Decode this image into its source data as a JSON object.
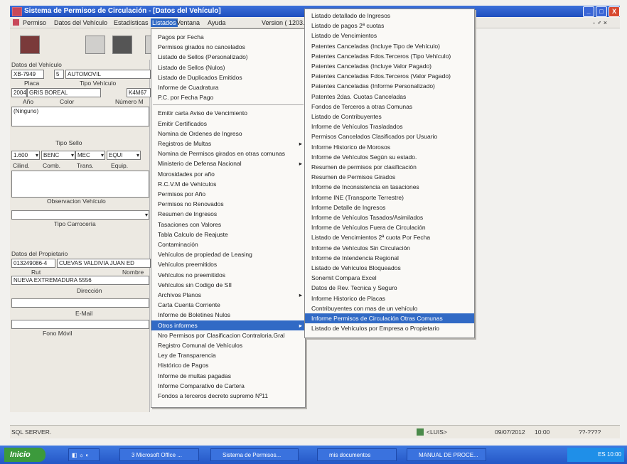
{
  "window": {
    "title": "Sistema de Permisos de Circulación - [Datos del Vehículo]",
    "controls": [
      "_",
      "□",
      "X"
    ],
    "inner_controls": "- ♂ ×"
  },
  "menubar": {
    "items": [
      "Permiso",
      "Datos del Vehículo",
      "Estadísticas",
      "Listados",
      "Ventana",
      "Ayuda"
    ],
    "version": "Version ( 1203."
  },
  "form": {
    "section_vehicle": "Datos del Vehículo",
    "plate": "XB-7949",
    "dv": "5",
    "vehicle_type_value": "AUTOMOVIL",
    "label_placa": "Placa",
    "label_tipo_vehiculo": "Tipo Vehículo",
    "year_value": "2004",
    "color_value": "GRIS BOREAL",
    "number_value": "K4M67",
    "label_ano": "Año",
    "label_color": "Color",
    "label_numero": "Número M",
    "ninguno": "(Ninguno)",
    "label_tipo_sello": "Tipo Sello",
    "cc_value": "1.600",
    "comb_value": "BENC",
    "trans_value": "MEC",
    "equip_value": "EQUI",
    "label_cilind": "Cilind.",
    "label_comb": "Comb.",
    "label_trans": "Trans.",
    "label_equip": "Equip.",
    "label_observacion": "Observacion Vehículo",
    "label_tipo_carroceria": "Tipo Carrocería",
    "section_owner": "Datos del Propietario",
    "rut_value": "013249086-4",
    "owner_name": "CUEVAS VALDIVIA JUAN ED",
    "label_rut": "Rut",
    "label_nombre": "Nombre",
    "address_value": "NUEVA EXTREMADURA 5556",
    "label_direccion": "Dirección",
    "label_email": "E-Mail",
    "label_fono": "Fono Móvil"
  },
  "listados_menu": [
    {
      "label": "Pagos por Fecha"
    },
    {
      "label": "Permisos girados no cancelados"
    },
    {
      "label": "Listado de Sellos (Personalizado)"
    },
    {
      "label": "Listado de Sellos (Nulos)"
    },
    {
      "label": "Listado de Duplicados Emitidos"
    },
    {
      "label": "Informe de Cuadratura"
    },
    {
      "label": "P.C. por Fecha Pago"
    },
    {
      "label": "Emitir carta Aviso de Vencimiento",
      "sep_before": true
    },
    {
      "label": "Emitir Certificados"
    },
    {
      "label": "Nomina de Ordenes de Ingreso"
    },
    {
      "label": "Registros de Multas",
      "sub": true
    },
    {
      "label": "Nomina de Permisos girados en otras comunas"
    },
    {
      "label": "Ministerio de Defensa Nacional",
      "sub": true
    },
    {
      "label": "Morosidades por año"
    },
    {
      "label": "R.C.V.M de Vehículos"
    },
    {
      "label": "Permisos por Año"
    },
    {
      "label": "Permisos no Renovados"
    },
    {
      "label": "Resumen de Ingresos"
    },
    {
      "label": "Tasaciones con Valores"
    },
    {
      "label": "Tabla Calculo de Reajuste"
    },
    {
      "label": "Contaminación"
    },
    {
      "label": "Vehículos de propiedad de Leasing"
    },
    {
      "label": "Vehículos preemitidos"
    },
    {
      "label": "Vehículos no preemitidos"
    },
    {
      "label": "Vehículos sin Codigo de SII"
    },
    {
      "label": "Archivos Planos",
      "sub": true
    },
    {
      "label": "Carta Cuenta Corriente"
    },
    {
      "label": "Informe de Boletines Nulos"
    },
    {
      "label": "Otros informes",
      "sub": true,
      "highlight": true
    },
    {
      "label": "Nro Permisos por Clasificacion Contraloria.Gral"
    },
    {
      "label": "Registro Comunal de Vehículos"
    },
    {
      "label": "Ley de Transparencia"
    },
    {
      "label": "Histórico de Pagos"
    },
    {
      "label": "Informe de multas pagadas"
    },
    {
      "label": "Informe Comparativo de Cartera"
    },
    {
      "label": "Fondos a terceros decreto supremo Nº11"
    }
  ],
  "otros_menu": [
    {
      "label": "Listado detallado de Ingresos"
    },
    {
      "label": "Listado de pagos 2ª cuotas"
    },
    {
      "label": "Listado de Vencimientos"
    },
    {
      "label": "Patentes Canceladas (Incluye Tipo de Vehículo)"
    },
    {
      "label": "Patentes Canceladas Fdos.Terceros (Tipo Vehículo)"
    },
    {
      "label": "Patentes Canceladas (Incluye Valor Pagado)"
    },
    {
      "label": "Patentes Canceladas Fdos.Terceros (Valor Pagado)"
    },
    {
      "label": "Patentes Canceladas (Informe Personalizado)"
    },
    {
      "label": "Patentes 2das. Cuotas Canceladas"
    },
    {
      "label": "Fondos de Terceros a otras Comunas"
    },
    {
      "label": "Listado de Contribuyentes"
    },
    {
      "label": "Informe de Vehículos Trasladados"
    },
    {
      "label": "Permisos Cancelados Clasificados por Usuario"
    },
    {
      "label": "Informe Historico de Morosos"
    },
    {
      "label": "Informe de Vehículos Según su estado."
    },
    {
      "label": "Resumen de permisos por clasificación"
    },
    {
      "label": "Resumen de Permisos Girados"
    },
    {
      "label": "Informe de Inconsistencia en tasaciones"
    },
    {
      "label": "Informe INE (Transporte Terrestre)"
    },
    {
      "label": "Informe Detalle de Ingresos"
    },
    {
      "label": "Informe de Vehículos Tasados/Asimilados"
    },
    {
      "label": "Informe de Vehículos Fuera de Circulación"
    },
    {
      "label": "Listado de Vencimientos 2ª cuota Por Fecha"
    },
    {
      "label": "Informe de Vehículos Sin Circulación"
    },
    {
      "label": "Informe de Intendencia Regional"
    },
    {
      "label": "Listado de Vehículos Bloqueados"
    },
    {
      "label": "Sonemit Compara Excel"
    },
    {
      "label": "Datos de Rev. Tecnica y Seguro"
    },
    {
      "label": "Informe Historico de Placas"
    },
    {
      "label": "Contribuyentes con mas de un vehículo"
    },
    {
      "label": "Informe Permisos de Circulación Otras Comunas",
      "highlight": true
    },
    {
      "label": "Listado de Vehículos por Empresa o Propietario"
    }
  ],
  "status": {
    "left": "SQL SERVER.",
    "user": "<LUIS>",
    "date": "09/07/2012",
    "time": "10:00",
    "extra": "??-????"
  },
  "taskbar": {
    "start": "Inicio",
    "tasks": [
      "3 Microsoft Office ...",
      "Sistema de Permisos...",
      "mis documentos",
      "MANUAL DE PROCE..."
    ],
    "tray_lang": "ES",
    "tray_time": "10:00"
  },
  "colors": {
    "highlight": "#316ac5",
    "titlebar": "#1f4fbf"
  }
}
